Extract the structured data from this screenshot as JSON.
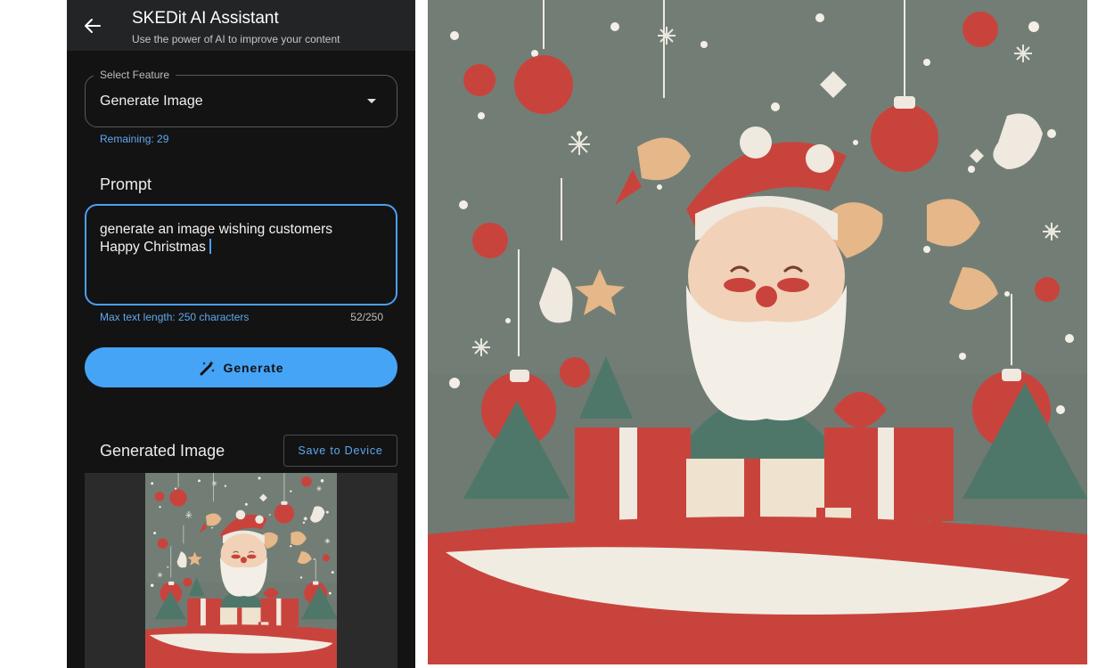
{
  "appbar": {
    "title": "SKEDit AI Assistant",
    "subtitle": "Use the power of AI to improve your content",
    "back_icon": "arrow-left-icon"
  },
  "feature_select": {
    "legend": "Select Feature",
    "value": "Generate Image",
    "dropdown_icon": "caret-down-icon"
  },
  "remaining": "Remaining: 29",
  "prompt": {
    "label": "Prompt",
    "value": "generate an image wishing customers\nHappy Christmas",
    "helper": "Max text length: 250 characters",
    "count": "52/250"
  },
  "generate_button": {
    "label": "Generate",
    "icon": "magic-wand-icon"
  },
  "generated": {
    "title": "Generated Image",
    "save_label": "Save to Device"
  },
  "colors": {
    "accent": "#45a4f6",
    "background": "#131314",
    "appbar": "#232425",
    "link_text": "#5fa8ef"
  }
}
